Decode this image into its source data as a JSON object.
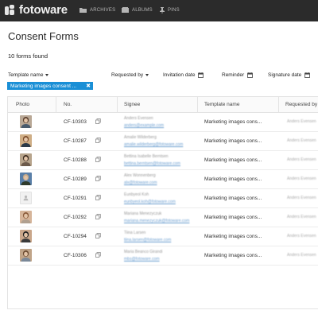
{
  "app": {
    "logo": "fotoware",
    "nav": [
      {
        "label": "ARCHIVES",
        "icon": "archive-icon"
      },
      {
        "label": "ALBUMS",
        "icon": "album-icon"
      },
      {
        "label": "PINS",
        "icon": "pin-icon"
      }
    ]
  },
  "page": {
    "title": "Consent Forms",
    "count": "10 forms found"
  },
  "filters": {
    "template_name": "Template name",
    "requested_by": "Requested by",
    "invitation_date": "Invitation date",
    "reminder": "Reminder",
    "signature_date": "Signature date",
    "active_chip": "Marketing images consent ..."
  },
  "table": {
    "columns": [
      "Photo",
      "No.",
      "Signee",
      "Template name",
      "Requested by"
    ],
    "rows": [
      {
        "no": "CF-10303",
        "name": "Anders Evensen",
        "email": "anders@example.com",
        "template": "Marketing images cons...",
        "requested_by": "Anders Evensen",
        "photo": "person"
      },
      {
        "no": "CF-10287",
        "name": "Amalie Wilderberg",
        "email": "amalie.wilderberg@fotoware.com",
        "template": "Marketing images cons...",
        "requested_by": "Anders Evensen",
        "photo": "person"
      },
      {
        "no": "CF-10288",
        "name": "Bettina Isabelle Berntsen",
        "email": "bettina.berntsen@fotoware.com",
        "template": "Marketing images cons...",
        "requested_by": "Anders Evensen",
        "photo": "person"
      },
      {
        "no": "CF-10289",
        "name": "Alex Wonnenberg",
        "email": "alx@fotoware.com",
        "template": "Marketing images cons...",
        "requested_by": "Anders Evensen",
        "photo": "person"
      },
      {
        "no": "CF-10291",
        "name": "Eunbyeol Koh",
        "email": "eunbyeol.koh@fotoware.com",
        "template": "Marketing images cons...",
        "requested_by": "Anders Evensen",
        "photo": "placeholder"
      },
      {
        "no": "CF-10292",
        "name": "Mariana Menezyczuk",
        "email": "mariana.menezyczuk@fotoware.com",
        "template": "Marketing images cons...",
        "requested_by": "Anders Evensen",
        "photo": "person"
      },
      {
        "no": "CF-10294",
        "name": "Tiina Larsen",
        "email": "tiina.larsen@fotoware.com",
        "template": "Marketing images cons...",
        "requested_by": "Anders Evensen",
        "photo": "person"
      },
      {
        "no": "CF-10306",
        "name": "Maria Beanco Girandi",
        "email": "mbs@fotoware.com",
        "template": "Marketing images cons...",
        "requested_by": "Anders Evensen",
        "photo": "person"
      }
    ]
  },
  "colors": {
    "topbar": "#2b2b2b",
    "accent": "#1a8fd6"
  }
}
